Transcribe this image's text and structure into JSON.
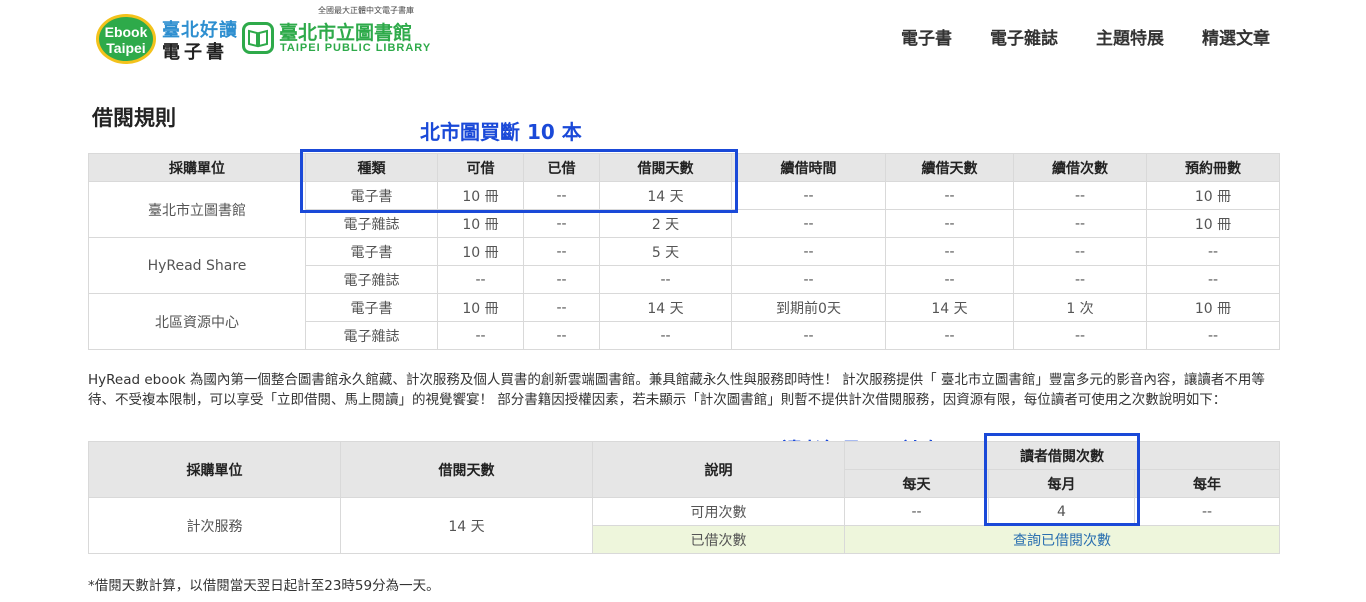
{
  "header": {
    "logo_tagline": "全國最大正體中文電子書庫",
    "logo_circle_line1": "Ebook",
    "logo_circle_line2": "Taipei",
    "logo_hao": "臺北好讀",
    "logo_ebook": "電子書",
    "logo_library_cn": "臺北市立圖書館",
    "logo_library_en": "TAIPEI PUBLIC LIBRARY"
  },
  "nav": {
    "items": [
      "電子書",
      "電子雜誌",
      "主題特展",
      "精選文章"
    ]
  },
  "page_title": "借閱規則",
  "annotations": {
    "top": "北市圖買斷 10 本",
    "bottom": "讀者每月可用計次"
  },
  "rules_table": {
    "headers": [
      "採購單位",
      "種類",
      "可借",
      "已借",
      "借閱天數",
      "續借時間",
      "續借天數",
      "續借次數",
      "預約冊數"
    ],
    "groups": [
      {
        "unit": "臺北市立圖書館",
        "rows": [
          [
            "電子書",
            "10 冊",
            "--",
            "14 天",
            "--",
            "--",
            "--",
            "10 冊"
          ],
          [
            "電子雜誌",
            "10 冊",
            "--",
            "2 天",
            "--",
            "--",
            "--",
            "10 冊"
          ]
        ]
      },
      {
        "unit": "HyRead Share",
        "rows": [
          [
            "電子書",
            "10 冊",
            "--",
            "5 天",
            "--",
            "--",
            "--",
            "--"
          ],
          [
            "電子雜誌",
            "--",
            "--",
            "--",
            "--",
            "--",
            "--",
            "--"
          ]
        ]
      },
      {
        "unit": "北區資源中心",
        "rows": [
          [
            "電子書",
            "10 冊",
            "--",
            "14 天",
            "到期前0天",
            "14 天",
            "1 次",
            "10 冊"
          ],
          [
            "電子雜誌",
            "--",
            "--",
            "--",
            "--",
            "--",
            "--",
            "--"
          ]
        ]
      }
    ]
  },
  "description": "HyRead ebook 為國內第一個整合圖書館永久館藏、計次服務及個人買書的創新雲端圖書館。兼具館藏永久性與服務即時性！ 計次服務提供「 臺北市立圖書館」豐富多元的影音內容，讓讀者不用等待、不受複本限制，可以享受「立即借閱、馬上閱讀」的視覺饗宴！ 部分書籍因授權因素，若未顯示「計次圖書館」則暫不提供計次借閱服務，因資源有限，每位讀者可使用之次數說明如下：",
  "count_table": {
    "h_unit": "採購單位",
    "h_days": "借閱天數",
    "h_desc": "說明",
    "h_count": "讀者借閱次數",
    "h_daily": "每天",
    "h_monthly": "每月",
    "h_yearly": "每年",
    "unit": "計次服務",
    "days": "14 天",
    "row1_label": "可用次數",
    "row1_daily": "--",
    "row1_monthly": "4",
    "row1_yearly": "--",
    "row2_label": "已借次數",
    "row2_link": "查詢已借閱次數"
  },
  "footnote": "*借閱天數計算，以借閱當天翌日起計至23時59分為一天。"
}
